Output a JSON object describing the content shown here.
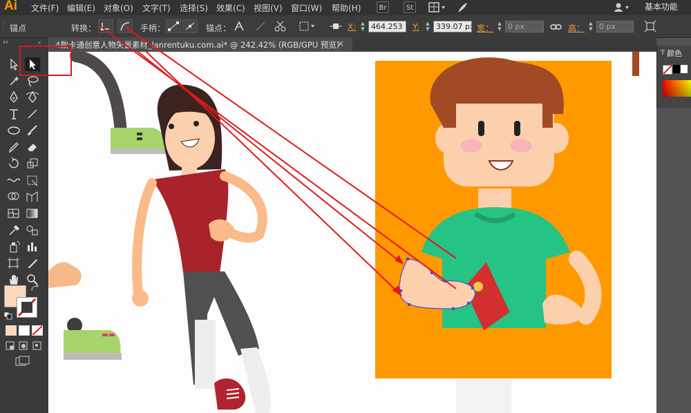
{
  "app": {
    "logo": "Ai"
  },
  "menu": {
    "items": [
      "文件(F)",
      "编辑(E)",
      "对象(O)",
      "文字(T)",
      "选择(S)",
      "效果(C)",
      "视图(V)",
      "窗口(W)",
      "帮助(H)"
    ],
    "icons": [
      {
        "label": "Br",
        "name": "bridge-icon"
      },
      {
        "label": "St",
        "name": "stock-icon"
      }
    ],
    "workspace": "基本功能"
  },
  "control": {
    "anchor_label": "锚点",
    "convert_label": "转换：",
    "handle_label": "手柄：",
    "anchor_point_label": "锚点：",
    "x_label": "X:",
    "x_value": "464.253 p",
    "y_label": "Y:",
    "y_value": "339.07 px",
    "width_label": "宽：",
    "width_value": "0 px",
    "height_label": "高：",
    "height_value": "0 px"
  },
  "document": {
    "title": "4款卡通创意人物矢量素材_lanrentuku.com.ai* @ 242.42% (RGB/GPU 预览)",
    "close": "×"
  },
  "panels": {
    "color_title": "颜色"
  },
  "colors": {
    "orange_bg": "#ff9900",
    "shirt_green": "#25c384",
    "hair_brown": "#a24a26",
    "skin": "#fcd9bd",
    "red_shirt": "#a8232a",
    "annotation_red": "#e0191a",
    "selection_blue": "#4a4ad6"
  }
}
